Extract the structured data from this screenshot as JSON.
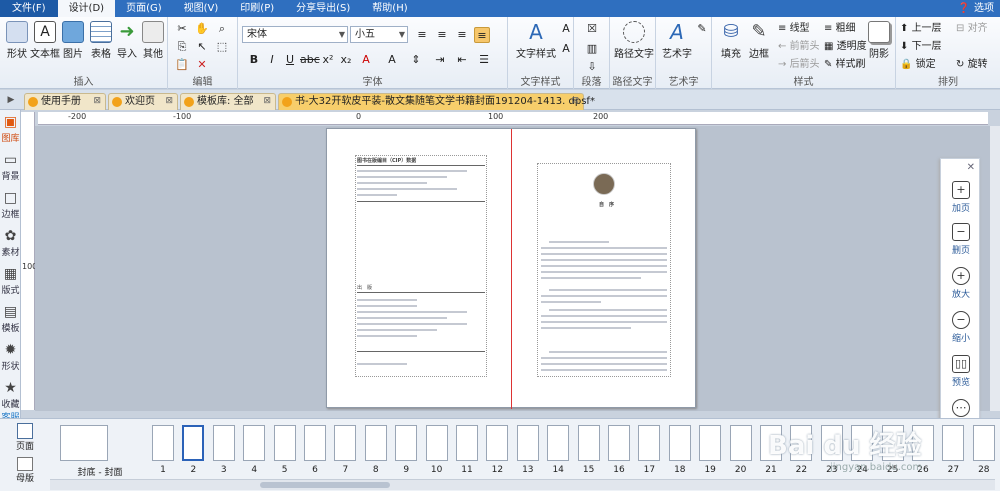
{
  "menu": {
    "file": "文件(F)",
    "items": [
      "设计(D)",
      "页面(G)",
      "视图(V)",
      "印刷(P)",
      "分享导出(S)",
      "帮助(H)"
    ],
    "right": "选项"
  },
  "ribbon": {
    "insert": {
      "shape": "形状",
      "textbox": "文本框",
      "image": "图片",
      "table": "表格",
      "import": "导入",
      "other": "其他",
      "label": "插入"
    },
    "edit": {
      "label": "编辑"
    },
    "font": {
      "family": "宋体",
      "size": "小五",
      "label": "字体"
    },
    "textstyle": {
      "btn": "文字样式",
      "label": "文字样式"
    },
    "paragraph": {
      "label": "段落"
    },
    "pathtext": {
      "btn": "路径文字",
      "label": "路径文字"
    },
    "arttext": {
      "btn": "艺术字",
      "label": "艺术字"
    },
    "style": {
      "fill": "填充",
      "border": "边框",
      "linetype": "线型",
      "thickness": "粗细",
      "frontarrow": "前箭头",
      "transparency": "透明度",
      "backarrow": "后箭头",
      "stylebrush": "样式刷",
      "shadow": "阴影",
      "label": "样式"
    },
    "arrange": {
      "up": "上一层",
      "down": "下一层",
      "lock": "锁定",
      "align": "对齐",
      "rotate": "旋转",
      "label": "排列"
    }
  },
  "tabs": [
    {
      "label": "使用手册"
    },
    {
      "label": "欢迎页"
    },
    {
      "label": "模板库: 全部"
    },
    {
      "label": "书-大32开软皮平装-散文集随笔文学书籍封面191204-1413. dpsf*"
    }
  ],
  "leftbar": [
    "图库",
    "背景",
    "边框",
    "素材",
    "版式",
    "模板",
    "形状",
    "收藏",
    "客服"
  ],
  "ruler": {
    "h": [
      "-200",
      "-100",
      "0",
      "100",
      "200"
    ],
    "v": [
      "100"
    ]
  },
  "page": {
    "left_heading": "图书在版编目（CIP）数据",
    "left_title2": "出　版",
    "right_title": "自　序"
  },
  "floatpanel": {
    "add": "加页",
    "delete": "删页",
    "zoomin": "放大",
    "zoomout": "缩小",
    "preview": "预览",
    "share": "分享"
  },
  "bottom": {
    "side_top": "页面",
    "side_bottom": "母版",
    "cover_label": "封底 - 封面",
    "pages": [
      "1",
      "2",
      "3",
      "4",
      "5",
      "6",
      "7",
      "8",
      "9",
      "10",
      "11",
      "12",
      "13",
      "14",
      "15",
      "16",
      "17",
      "18",
      "19",
      "20",
      "21",
      "22",
      "23",
      "24",
      "25",
      "26",
      "27",
      "28"
    ]
  },
  "watermark": {
    "brand": "Bai du 经验",
    "sub": "jingyan.baidu.com"
  },
  "colors": {
    "menubar": "#2f6fbf",
    "accent": "#e05a12",
    "tab_active": "#f7ce6b",
    "spine": "#dd3333"
  }
}
